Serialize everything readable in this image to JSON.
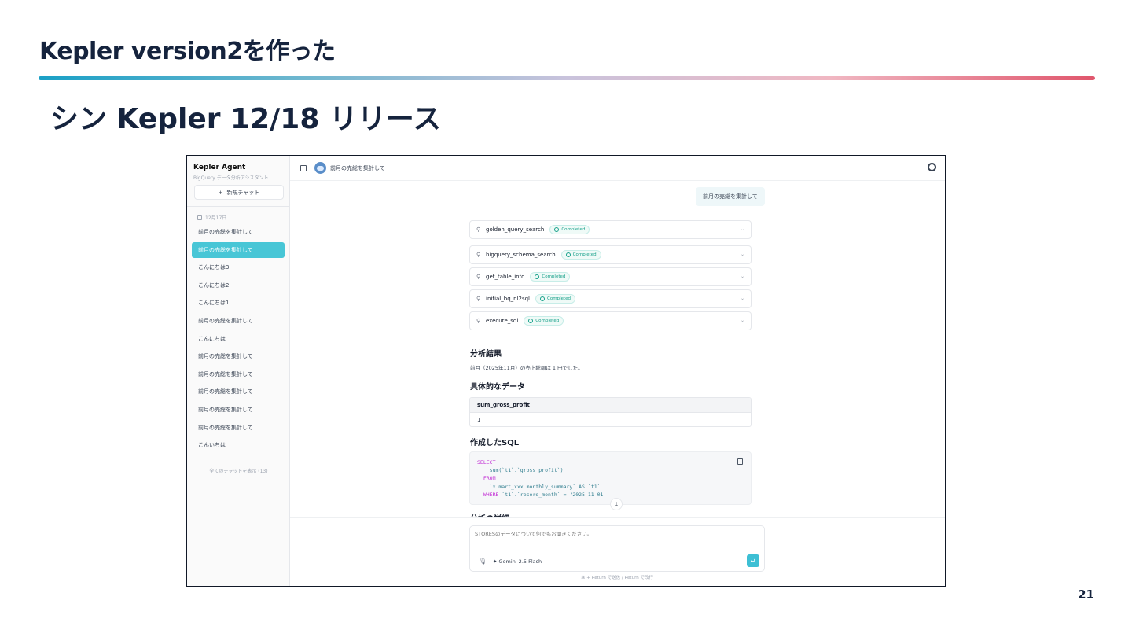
{
  "slide": {
    "title": "Kepler version2を作った",
    "subtitle": "シン Kepler 12/18 リリース",
    "page_number": "21"
  },
  "sidebar": {
    "brand": "Kepler Agent",
    "brand_sub": "BigQuery データ分析アシスタント",
    "new_chat_label": "新規チャット",
    "date_group": "12月17日",
    "items": [
      {
        "label": "前月の売総を集計して",
        "active": false
      },
      {
        "label": "前月の売総を集計して",
        "active": true
      },
      {
        "label": "こんにちは3",
        "active": false
      },
      {
        "label": "こんにちは2",
        "active": false
      },
      {
        "label": "こんにちは1",
        "active": false
      },
      {
        "label": "前月の売総を集計して",
        "active": false
      },
      {
        "label": "こんにちは",
        "active": false
      },
      {
        "label": "前月の売総を集計して",
        "active": false
      },
      {
        "label": "前月の売総を集計して",
        "active": false
      },
      {
        "label": "前月の売総を集計して",
        "active": false
      },
      {
        "label": "前月の売総を集計して",
        "active": false
      },
      {
        "label": "前月の売総を集計して",
        "active": false
      },
      {
        "label": "こんいちは",
        "active": false
      }
    ],
    "show_all": "全てのチャットを表示 (13)"
  },
  "topbar": {
    "title": "前月の売総を集計して"
  },
  "chat": {
    "user_message": "前月の売総を集計して",
    "tools": [
      {
        "name": "golden_query_search",
        "status": "Completed"
      },
      {
        "name": "bigquery_schema_search",
        "status": "Completed"
      },
      {
        "name": "get_table_info",
        "status": "Completed"
      },
      {
        "name": "initial_bq_nl2sql",
        "status": "Completed"
      },
      {
        "name": "execute_sql",
        "status": "Completed"
      }
    ],
    "result_heading": "分析結果",
    "result_text": "前月（2025年11月）の売上総額は 1 円でした。",
    "data_heading": "具体的なデータ",
    "table": {
      "columns": [
        "sum_gross_profit"
      ],
      "rows": [
        [
          "1"
        ]
      ]
    },
    "sql_heading": "作成したSQL",
    "sql": {
      "kw_select": "SELECT",
      "line2": "    sum(`t1`.`gross_profit`)",
      "kw_from": "  FROM",
      "line4": "    `x.mart_xxx.monthly_summary` AS `t1`",
      "kw_where": "  WHERE",
      "line5_rest": " `t1`.`record_month` = '2025-11-01'"
    },
    "cut_heading": "分析の詳細"
  },
  "composer": {
    "placeholder": "STORESのデータについて何でもお聞きください。",
    "model": "Gemini 2.5 Flash",
    "hint": "⌘ + Return で送信 / Return で改行"
  },
  "colors": {
    "accent": "#48c6d6",
    "completed": "#16a08a",
    "title": "#15233d"
  }
}
